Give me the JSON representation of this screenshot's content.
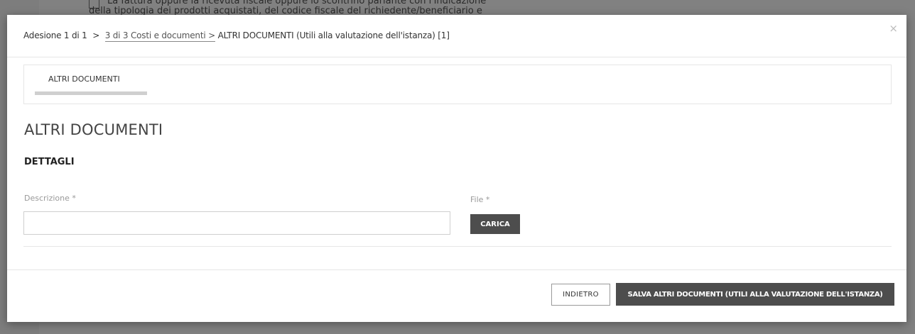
{
  "background": {
    "line1": "La fattura oppure la ricevuta fiscale oppure lo scontrino parlante con l'indicazione",
    "line2": "della tipologia dei prodotti acquistati, del codice fiscale del richiedente/beneficiario e"
  },
  "modal": {
    "breadcrumb": {
      "step1": "Adesione 1 di 1",
      "sep": ">",
      "step2": "3 di 3 Costi e documenti",
      "step3": "ALTRI DOCUMENTI (Utili alla valutazione dell'istanza) [1]"
    },
    "close_icon": "×",
    "tabs": [
      {
        "label": "ALTRI DOCUMENTI"
      }
    ],
    "section_title": "ALTRI DOCUMENTI",
    "subsection_title": "DETTAGLI",
    "form": {
      "description_label": "Descrizione *",
      "description_value": "",
      "file_label": "File *",
      "upload_label": "CARICA"
    },
    "footer": {
      "back_label": "INDIETRO",
      "save_label": "SALVA ALTRI DOCUMENTI (UTILI ALLA VALUTAZIONE DELL'ISTANZA)"
    }
  }
}
